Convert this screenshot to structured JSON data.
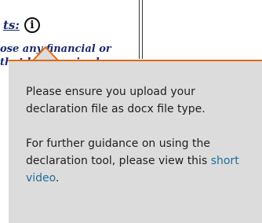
{
  "heading": {
    "label": "ts:",
    "info_glyph": "i"
  },
  "body_text": {
    "line1": "ose any financial or",
    "line2": "that     be perceived"
  },
  "tooltip": {
    "message1": "Please ensure you upload your declaration file as docx file type.",
    "message2_prefix": "For further guidance on using the declaration tool, please view this ",
    "link_text": "short video",
    "message2_suffix": "."
  },
  "colors": {
    "heading_text": "#1a2a6e",
    "tooltip_bg": "#dcdcdc",
    "tooltip_accent": "#e06a12",
    "link": "#1f6f9a"
  },
  "icons": {
    "info": "info-icon"
  }
}
